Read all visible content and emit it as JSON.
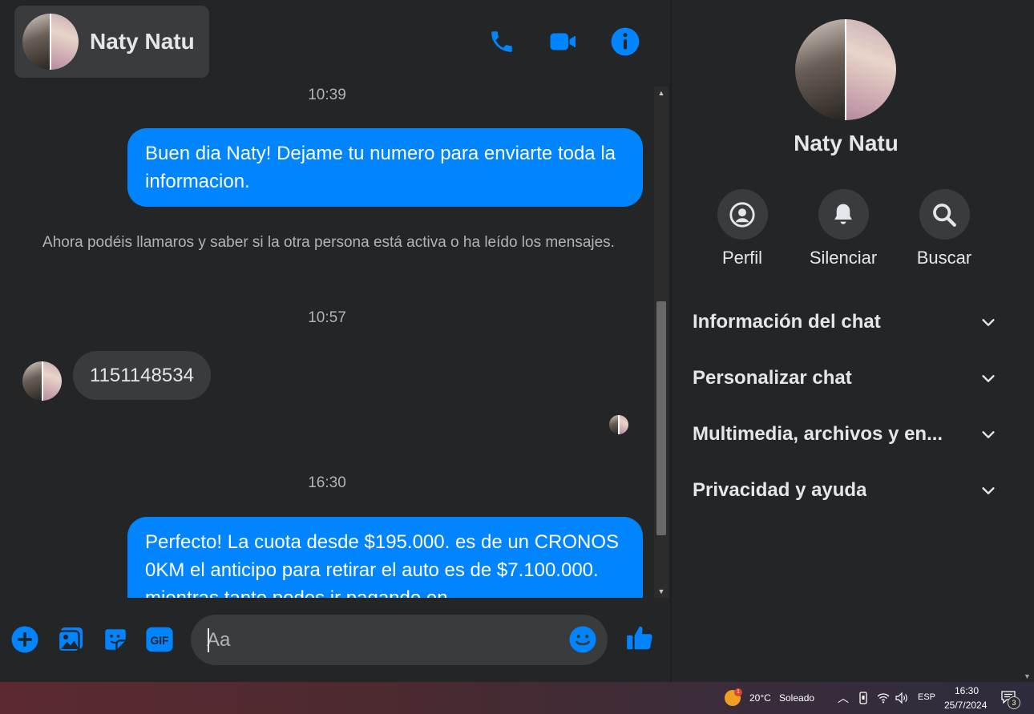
{
  "header": {
    "contact_name": "Naty Natu"
  },
  "messages": {
    "timestamps": [
      "10:39",
      "10:57",
      "16:30"
    ],
    "out_1": "Buen dia Naty! Dejame tu numero para enviarte toda la informacion.",
    "system_note": "Ahora podéis llamaros y saber si la otra persona está activa o ha leído los mensajes.",
    "in_1": "1151148534",
    "out_2": "Perfecto! La cuota desde $195.000. es de un CRONOS 0KM el anticipo para retirar el auto es de $7.100.000. mientras tanto podes ir pagando en"
  },
  "composer": {
    "placeholder": "Aa"
  },
  "sidebar": {
    "name": "Naty Natu",
    "actions": [
      {
        "label": "Perfil",
        "icon": "profile-icon"
      },
      {
        "label": "Silenciar",
        "icon": "bell-icon"
      },
      {
        "label": "Buscar",
        "icon": "search-icon"
      }
    ],
    "sections": [
      {
        "label": "Información del chat"
      },
      {
        "label": "Personalizar chat"
      },
      {
        "label": "Multimedia, archivos y en..."
      },
      {
        "label": "Privacidad y ayuda"
      }
    ]
  },
  "taskbar": {
    "weather_temp": "20°C",
    "weather_desc": "Soleado",
    "weather_badge": "1",
    "lang": "ESP",
    "time": "16:30",
    "date": "25/7/2024",
    "notifications": "3"
  },
  "colors": {
    "accent": "#0084ff",
    "background": "#242526",
    "bubble_in": "#3a3b3c"
  }
}
